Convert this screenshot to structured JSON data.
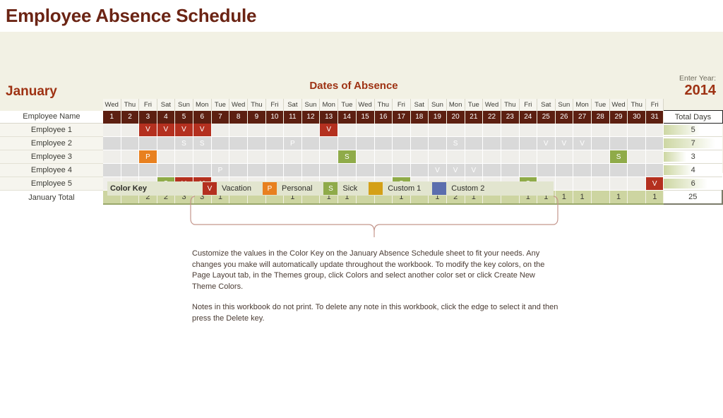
{
  "title": "Employee Absence Schedule",
  "sheet": {
    "month_label": "January",
    "section_title": "Dates of Absence",
    "enter_year_label": "Enter Year:",
    "year_value": "2014",
    "name_header": "Employee Name",
    "total_header": "Total Days",
    "total_row_label": "January Total",
    "grand_total": "25"
  },
  "days": [
    {
      "num": "1",
      "dow": "Wed"
    },
    {
      "num": "2",
      "dow": "Thu"
    },
    {
      "num": "3",
      "dow": "Fri"
    },
    {
      "num": "4",
      "dow": "Sat"
    },
    {
      "num": "5",
      "dow": "Sun"
    },
    {
      "num": "6",
      "dow": "Mon"
    },
    {
      "num": "7",
      "dow": "Tue"
    },
    {
      "num": "8",
      "dow": "Wed"
    },
    {
      "num": "9",
      "dow": "Thu"
    },
    {
      "num": "10",
      "dow": "Fri"
    },
    {
      "num": "11",
      "dow": "Sat"
    },
    {
      "num": "12",
      "dow": "Sun"
    },
    {
      "num": "13",
      "dow": "Mon"
    },
    {
      "num": "14",
      "dow": "Tue"
    },
    {
      "num": "15",
      "dow": "Wed"
    },
    {
      "num": "16",
      "dow": "Thu"
    },
    {
      "num": "17",
      "dow": "Fri"
    },
    {
      "num": "18",
      "dow": "Sat"
    },
    {
      "num": "19",
      "dow": "Sun"
    },
    {
      "num": "20",
      "dow": "Mon"
    },
    {
      "num": "21",
      "dow": "Tue"
    },
    {
      "num": "22",
      "dow": "Wed"
    },
    {
      "num": "23",
      "dow": "Thu"
    },
    {
      "num": "24",
      "dow": "Fri"
    },
    {
      "num": "25",
      "dow": "Sat"
    },
    {
      "num": "26",
      "dow": "Sun"
    },
    {
      "num": "27",
      "dow": "Mon"
    },
    {
      "num": "28",
      "dow": "Tue"
    },
    {
      "num": "29",
      "dow": "Wed"
    },
    {
      "num": "30",
      "dow": "Thu"
    },
    {
      "num": "31",
      "dow": "Fri"
    }
  ],
  "employees": [
    {
      "name": "Employee 1",
      "total": "5",
      "marks": {
        "3": "V",
        "4": "V",
        "5": "V",
        "6": "V",
        "13": "V"
      }
    },
    {
      "name": "Employee 2",
      "total": "7",
      "marks": {
        "5": "S",
        "6": "S",
        "11": "P",
        "20": "S",
        "25": "V",
        "26": "V",
        "27": "V"
      }
    },
    {
      "name": "Employee 3",
      "total": "3",
      "marks": {
        "3": "P",
        "14": "S",
        "29": "S"
      }
    },
    {
      "name": "Employee 4",
      "total": "4",
      "marks": {
        "7": "P",
        "19": "V",
        "20": "V",
        "21": "V"
      }
    },
    {
      "name": "Employee 5",
      "total": "6",
      "marks": {
        "4": "S",
        "5": "V",
        "6": "V",
        "17": "S",
        "24": "S",
        "31": "V"
      }
    }
  ],
  "day_totals": {
    "3": "2",
    "4": "2",
    "5": "3",
    "6": "3",
    "7": "1",
    "11": "1",
    "13": "1",
    "14": "1",
    "17": "1",
    "19": "1",
    "20": "2",
    "21": "1",
    "24": "1",
    "25": "1",
    "26": "1",
    "27": "1",
    "29": "1",
    "31": "1"
  },
  "color_key": {
    "title": "Color Key",
    "items": [
      {
        "code": "V",
        "label": "Vacation",
        "color": "#b4301f"
      },
      {
        "code": "P",
        "label": "Personal",
        "color": "#e8801f"
      },
      {
        "code": "S",
        "label": "Sick",
        "color": "#8fab49"
      },
      {
        "code": "",
        "label": "Custom 1",
        "color": "#d4a017"
      },
      {
        "code": "",
        "label": "Custom 2",
        "color": "#5b6eae"
      }
    ]
  },
  "notes": {
    "paragraph_1": "Customize the values in the Color Key on the January Absence Schedule sheet to fit your needs. Any changes you make will automatically update throughout the workbook.  To modify the key colors, on the Page Layout tab, in the Themes group, click Colors and select another color set or click Create New Theme Colors.",
    "paragraph_2": "Notes in this workbook do not print. To delete any note in this workbook, click the edge to select it and then press the Delete key."
  }
}
